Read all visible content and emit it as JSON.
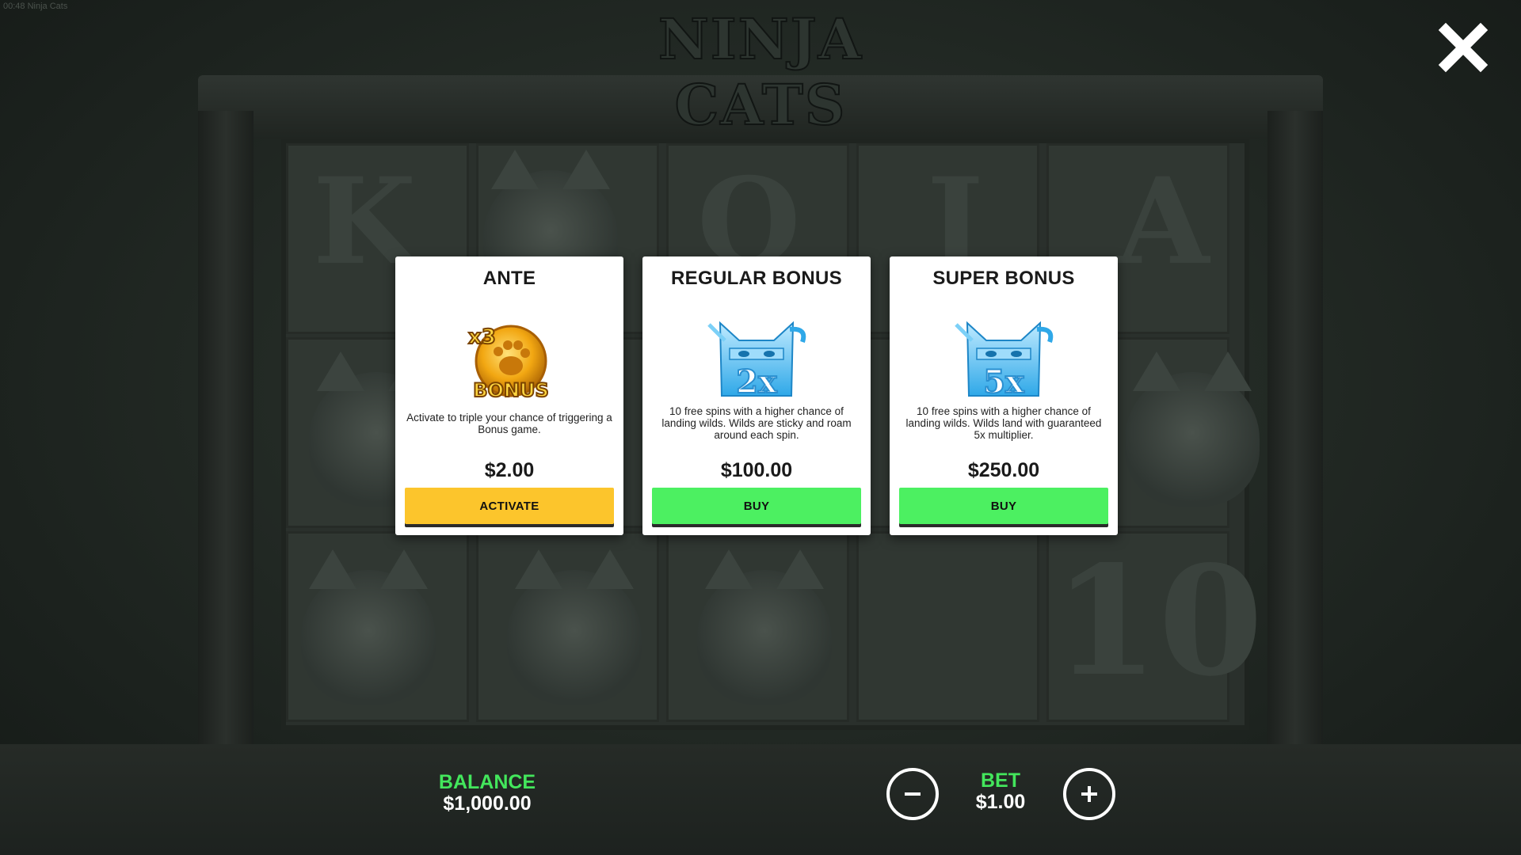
{
  "game": {
    "timestamp_title": "00:48 Ninja Cats",
    "logo_text": "NINJA CATS"
  },
  "close": {
    "icon": "close-icon"
  },
  "cards": [
    {
      "title": "ANTE",
      "art": "x3-paw-bonus-coin-icon",
      "art_multiplier": "x3",
      "art_text": "BONUS",
      "description": "Activate to triple your chance of triggering a Bonus game.",
      "price": "$2.00",
      "button_label": "ACTIVATE",
      "button_color": "#fcc52c"
    },
    {
      "title": "REGULAR BONUS",
      "art": "ice-ninja-cat-2x-icon",
      "art_text": "2x",
      "description": "10 free spins with a higher chance of landing wilds. Wilds are sticky and roam around each spin.",
      "price": "$100.00",
      "button_label": "BUY",
      "button_color": "#4cf061"
    },
    {
      "title": "SUPER BONUS",
      "art": "ice-ninja-cat-5x-icon",
      "art_text": "5x",
      "description": "10 free spins with a higher chance of landing wilds. Wilds land with guaranteed 5x multiplier.",
      "price": "$250.00",
      "button_label": "BUY",
      "button_color": "#4cf061"
    }
  ],
  "footer": {
    "balance_label": "BALANCE",
    "balance_value": "$1,000.00",
    "bet_label": "BET",
    "bet_value": "$1.00",
    "decrease_icon": "minus-icon",
    "increase_icon": "plus-icon"
  },
  "colors": {
    "accent_green": "#43e65c",
    "button_yellow": "#fcc52c",
    "button_green": "#4cf061"
  }
}
